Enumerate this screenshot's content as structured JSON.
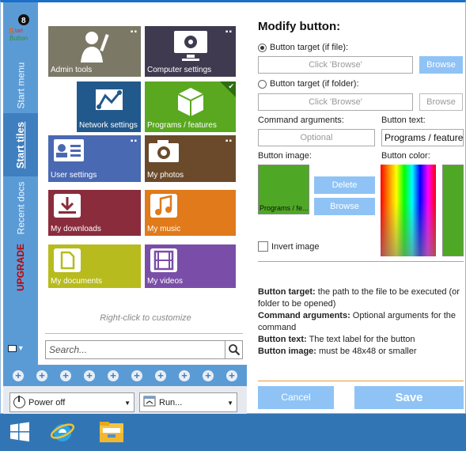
{
  "sidebar": {
    "tabs": [
      {
        "label": "Start menu"
      },
      {
        "label": "Start tiles"
      },
      {
        "label": "Recent docs"
      },
      {
        "label": "UPGRADE"
      }
    ]
  },
  "tiles": [
    {
      "label": "Admin tools",
      "color": "#7b7866",
      "icon": "admin-tools-icon"
    },
    {
      "label": "Computer settings",
      "color": "#3f3a4f",
      "icon": "computer-settings-icon"
    },
    {
      "label": "Network settings",
      "color": "#22598c",
      "icon": "network-icon"
    },
    {
      "label": "Programs / features",
      "color": "#5aa820",
      "icon": "box-icon"
    },
    {
      "label": "User settings",
      "color": "#4a69b3",
      "icon": "id-card-icon"
    },
    {
      "label": "My photos",
      "color": "#6a4a2a",
      "icon": "camera-icon"
    },
    {
      "label": "My downloads",
      "color": "#8a2c3c",
      "icon": "download-icon"
    },
    {
      "label": "My music",
      "color": "#e07a1a",
      "icon": "music-icon"
    },
    {
      "label": "My documents",
      "color": "#b8bb1d",
      "icon": "document-icon"
    },
    {
      "label": "My videos",
      "color": "#7a4ea8",
      "icon": "film-icon"
    }
  ],
  "hint": "Right-click to customize",
  "search": {
    "placeholder": "Search..."
  },
  "bottom": {
    "power": "Power off",
    "run": "Run..."
  },
  "panel": {
    "title": "Modify button:",
    "target_file_label": "Button target (if file):",
    "target_file_placeholder": "Click 'Browse'",
    "browse_label": "Browse",
    "target_folder_label": "Button target (if folder):",
    "target_folder_placeholder": "Click 'Browse'",
    "browse2_label": "Browse",
    "cmd_args_label": "Command arguments:",
    "cmd_args_placeholder": "Optional",
    "button_text_label": "Button text:",
    "button_text_value": "Programs / features",
    "button_image_label": "Button image:",
    "button_image_caption": "Programs / fe...",
    "button_color_label": "Button color:",
    "delete_label": "Delete",
    "browse3_label": "Browse",
    "invert_label": "Invert image",
    "desc": [
      {
        "term": "Button target:",
        "text": " the path to the file to be executed (or folder to be opened)"
      },
      {
        "term": "Command arguments:",
        "text": " Optional arguments for the command"
      },
      {
        "term": "Button text:",
        "text": " The text label for the button"
      },
      {
        "term": "Button image:",
        "text": " must be 48x48 or smaller"
      }
    ],
    "cancel_label": "Cancel",
    "save_label": "Save",
    "selected_color": "#4fa825"
  }
}
